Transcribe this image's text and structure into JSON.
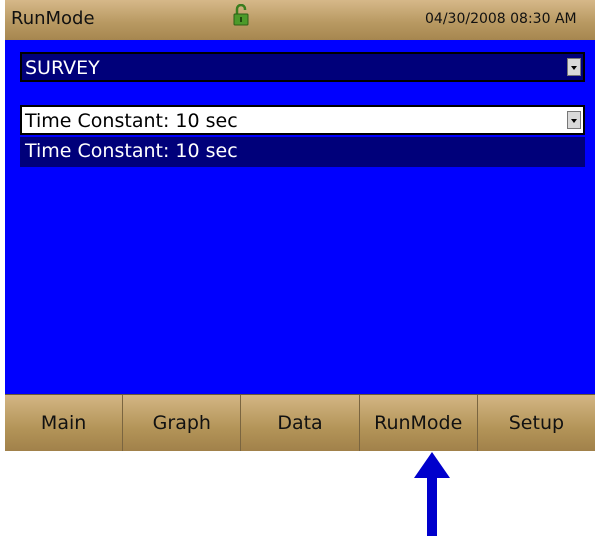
{
  "window": {
    "title": "RunMode",
    "datetime": "04/30/2008 08:30 AM",
    "lock_icon": "unlocked-padlock-icon"
  },
  "main": {
    "mode_select": {
      "value": "SURVEY"
    },
    "time_constant_select": {
      "value": "Time Constant: 10 sec"
    },
    "dropdown_options": [
      "Time Constant: 10 sec"
    ]
  },
  "tabs": [
    {
      "label": "Main"
    },
    {
      "label": "Graph"
    },
    {
      "label": "Data"
    },
    {
      "label": "RunMode",
      "active": true
    },
    {
      "label": "Setup"
    }
  ],
  "annotation": {
    "icon": "up-arrow-icon",
    "color": "#0000cc"
  },
  "colors": {
    "screen": "#0000ff",
    "chrome": "#c4a46e",
    "selected": "#00007a"
  }
}
